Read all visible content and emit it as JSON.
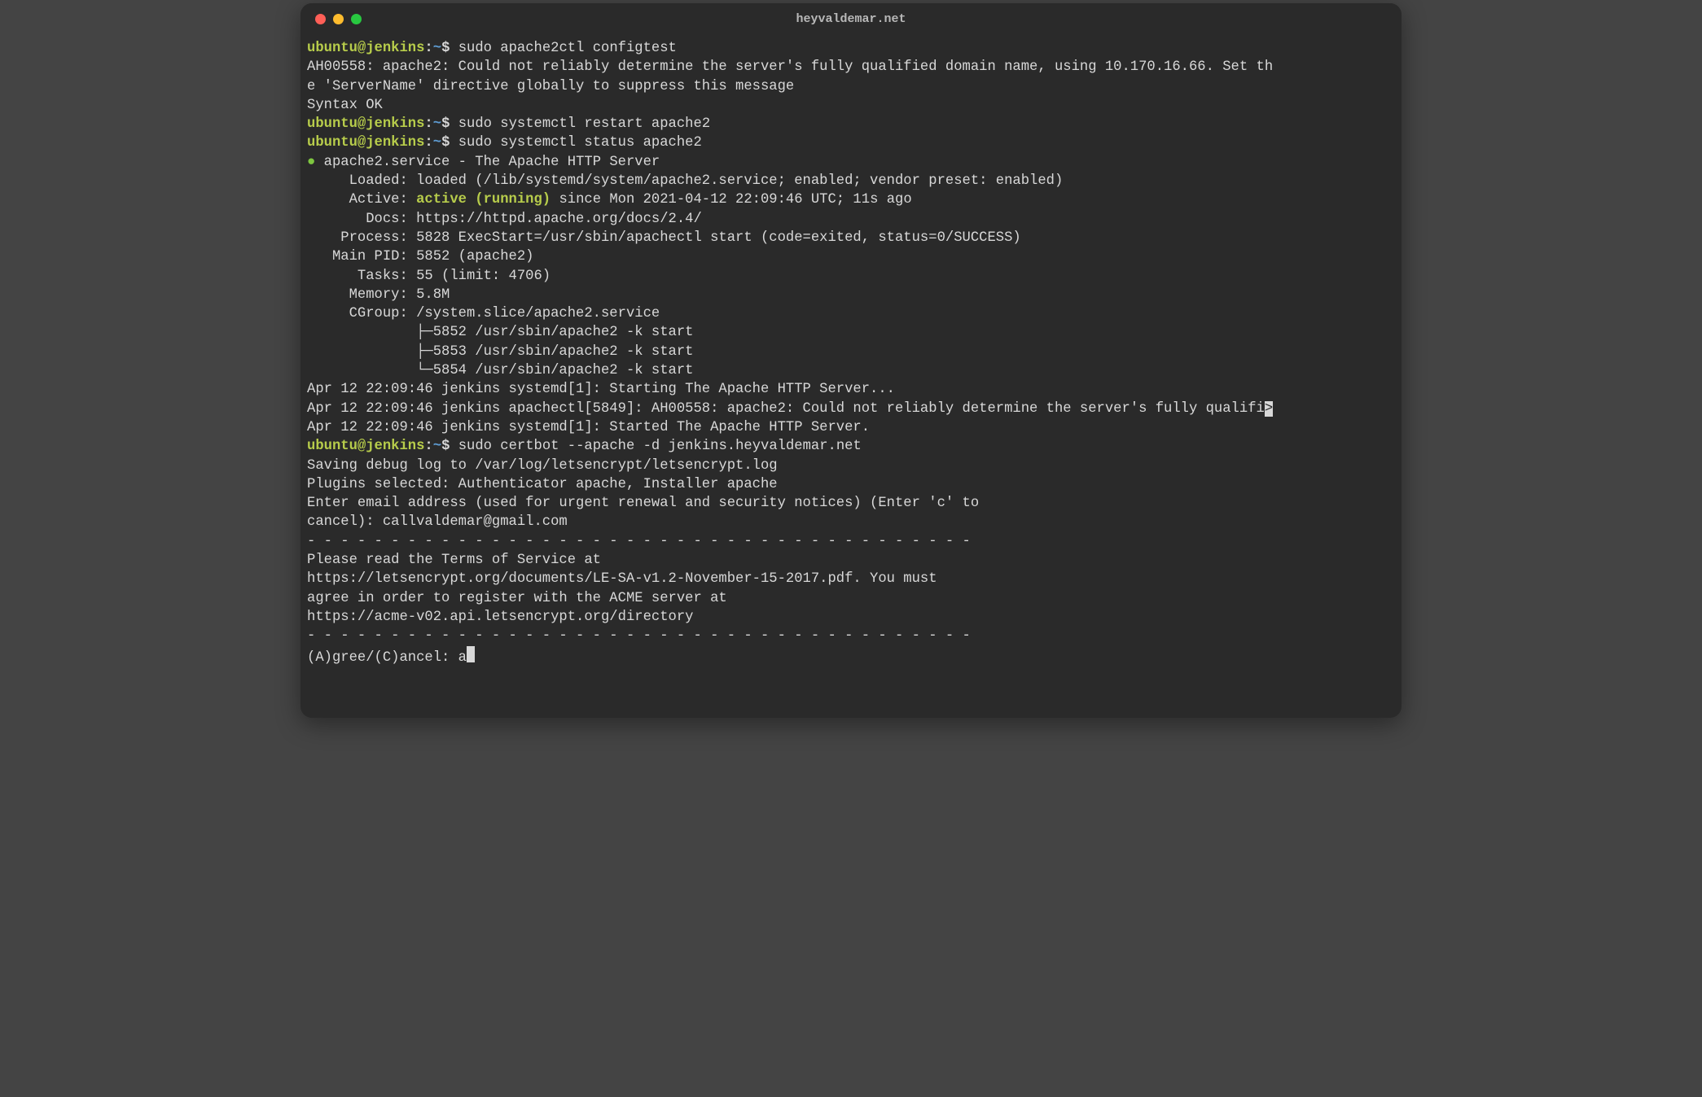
{
  "window": {
    "title": "heyvaldemar.net"
  },
  "prompt": {
    "user_host": "ubuntu@jenkins",
    "colon": ":",
    "path": "~",
    "dollar": "$ "
  },
  "cmd1": "sudo apache2ctl configtest",
  "out1_l1": "AH00558: apache2: Could not reliably determine the server's fully qualified domain name, using 10.170.16.66. Set th",
  "out1_l2": "e 'ServerName' directive globally to suppress this message",
  "out1_l3": "Syntax OK",
  "cmd2": "sudo systemctl restart apache2",
  "cmd3": "sudo systemctl status apache2",
  "status": {
    "dot": "●",
    "header": " apache2.service - The Apache HTTP Server",
    "loaded": "     Loaded: loaded (/lib/systemd/system/apache2.service; enabled; vendor preset: enabled)",
    "active_pre": "     Active: ",
    "active_val": "active (running)",
    "active_post": " since Mon 2021-04-12 22:09:46 UTC; 11s ago",
    "docs": "       Docs: https://httpd.apache.org/docs/2.4/",
    "process": "    Process: 5828 ExecStart=/usr/sbin/apachectl start (code=exited, status=0/SUCCESS)",
    "mainpid": "   Main PID: 5852 (apache2)",
    "tasks": "      Tasks: 55 (limit: 4706)",
    "memory": "     Memory: 5.8M",
    "cgroup": "     CGroup: /system.slice/apache2.service",
    "proc1": "             ├─5852 /usr/sbin/apache2 -k start",
    "proc2": "             ├─5853 /usr/sbin/apache2 -k start",
    "proc3": "             └─5854 /usr/sbin/apache2 -k start"
  },
  "log1": "Apr 12 22:09:46 jenkins systemd[1]: Starting The Apache HTTP Server...",
  "log2_pre": "Apr 12 22:09:46 jenkins apachectl[5849]: AH00558: apache2: Could not reliably determine the server's fully qualifi",
  "log2_end": ">",
  "log3": "Apr 12 22:09:46 jenkins systemd[1]: Started The Apache HTTP Server.",
  "cmd4": "sudo certbot --apache -d jenkins.heyvaldemar.net",
  "cb1": "Saving debug log to /var/log/letsencrypt/letsencrypt.log",
  "cb2": "Plugins selected: Authenticator apache, Installer apache",
  "cb3": "Enter email address (used for urgent renewal and security notices) (Enter 'c' to",
  "cb4": "cancel): callvaldemar@gmail.com",
  "blank": "",
  "dashes": "- - - - - - - - - - - - - - - - - - - - - - - - - - - - - - - - - - - - - - - -",
  "tos1": "Please read the Terms of Service at",
  "tos2": "https://letsencrypt.org/documents/LE-SA-v1.2-November-15-2017.pdf. You must",
  "tos3": "agree in order to register with the ACME server at",
  "tos4": "https://acme-v02.api.letsencrypt.org/directory",
  "agree_prompt": "(A)gree/(C)ancel: a"
}
